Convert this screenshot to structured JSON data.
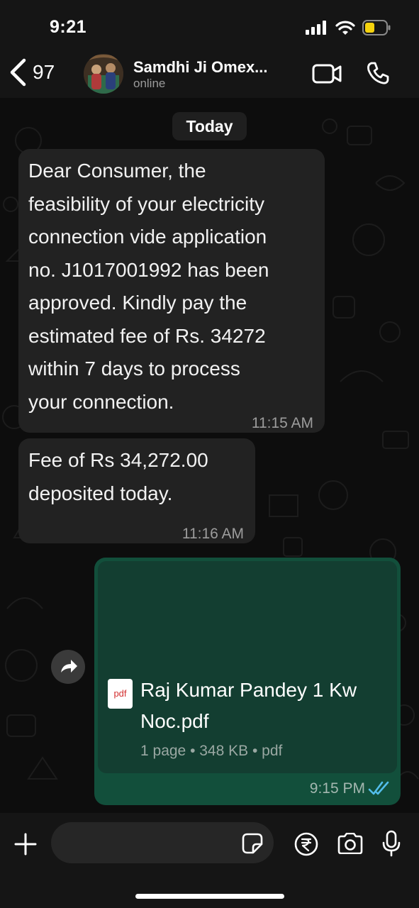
{
  "status_bar": {
    "time": "9:21",
    "icons": [
      "signal-icon",
      "wifi-icon",
      "battery-icon"
    ],
    "battery_color": "#f5d20d"
  },
  "header": {
    "back_count": "97",
    "contact_name": "Samdhi Ji Omex...",
    "contact_status": "online",
    "icons": [
      "back-chevron-icon",
      "video-call-icon",
      "phone-call-icon"
    ]
  },
  "chat": {
    "date_label": "Today",
    "messages": [
      {
        "direction": "incoming",
        "lines": [
          "Dear Consumer, the",
          "feasibility of your electricity",
          "connection vide application",
          "no. J1017001992 has been",
          "approved. Kindly pay the",
          "estimated fee of Rs. 34272",
          "within 7 days to process",
          "your connection."
        ],
        "time": "11:15 AM"
      },
      {
        "direction": "incoming",
        "lines": [
          "Fee of Rs 34,272.00",
          "deposited today."
        ],
        "time": "11:16 AM"
      },
      {
        "direction": "outgoing",
        "type": "document",
        "file_icon_label": "pdf",
        "file_name": "Raj Kumar Pandey 1 Kw Noc.pdf",
        "file_meta": "1 page • 348 KB • pdf",
        "time": "9:15 PM",
        "status": "read"
      }
    ]
  },
  "composer": {
    "placeholder": "",
    "icons": [
      "plus-icon",
      "sticker-icon",
      "rupee-payment-icon",
      "camera-icon",
      "microphone-icon"
    ]
  },
  "colors": {
    "background": "#0b0b0b",
    "bar": "#151515",
    "incoming_bubble": "#222222",
    "outgoing_bubble": "#124f3b",
    "document_card": "#133e31",
    "read_ticks": "#53bdeb"
  }
}
